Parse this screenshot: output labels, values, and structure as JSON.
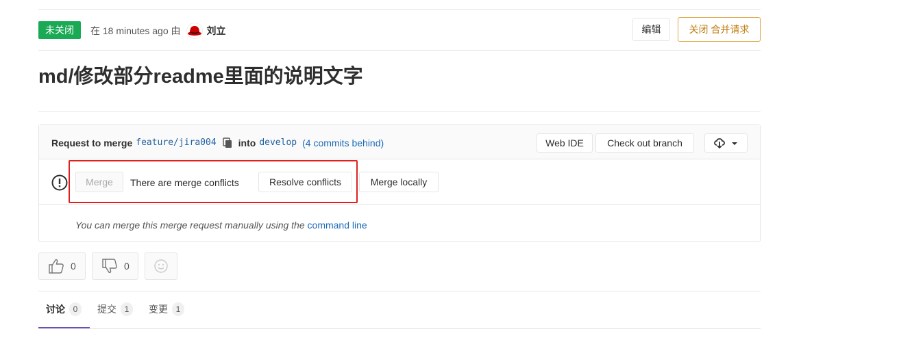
{
  "header": {
    "status_badge": "未关闭",
    "meta_prefix": "在 18 minutes ago 由",
    "author": "刘立",
    "edit_label": "编辑",
    "close_label": "关闭 合并请求"
  },
  "title": "md/修改部分readme里面的说明文字",
  "widget": {
    "request_label": "Request to merge",
    "source_branch": "feature/jira004",
    "into_label": "into",
    "target_branch": "develop",
    "commits_behind_open": "(",
    "commits_behind_link": "4 commits behind",
    "commits_behind_close": ")",
    "web_ide_label": "Web IDE",
    "checkout_label": "Check out branch",
    "merge_label": "Merge",
    "conflict_text": "There are merge conflicts",
    "resolve_label": "Resolve conflicts",
    "merge_locally_label": "Merge locally",
    "manual_text": "You can merge this merge request manually using the",
    "manual_link": "command line"
  },
  "awards": {
    "thumbsup_count": "0",
    "thumbsdown_count": "0"
  },
  "tabs": [
    {
      "label": "讨论",
      "count": "0"
    },
    {
      "label": "提交",
      "count": "1"
    },
    {
      "label": "变更",
      "count": "1"
    }
  ],
  "colors": {
    "open_badge": "#1aaa55",
    "close_button": "#c17d10",
    "link": "#1b69b6",
    "highlight_box": "#e02020",
    "active_tab": "#6b4fbb"
  }
}
